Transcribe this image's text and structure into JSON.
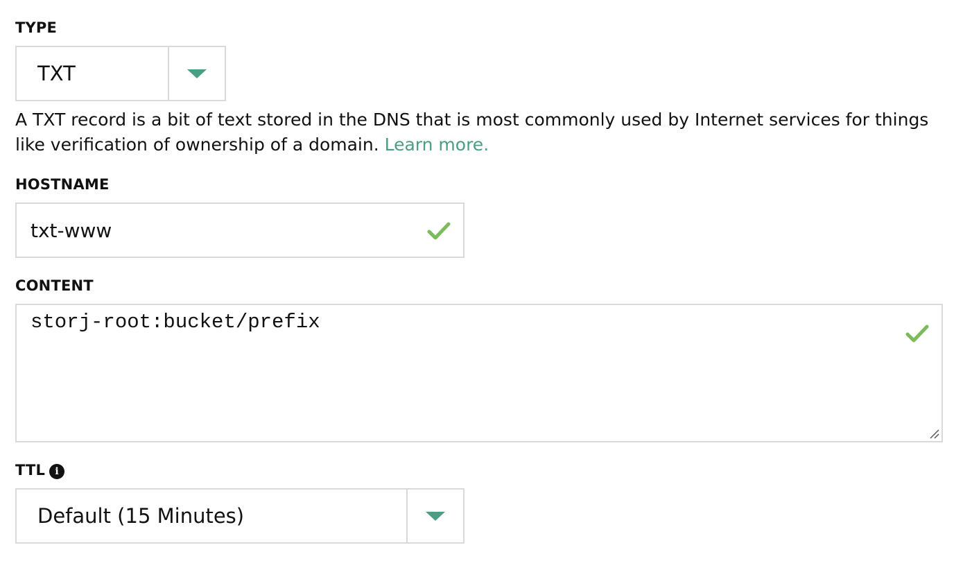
{
  "type_field": {
    "label": "TYPE",
    "selected": "TXT",
    "caret_icon": "caret-down-icon"
  },
  "help": {
    "text": "A TXT record is a bit of text stored in the DNS that is most commonly used by Internet services for things like verification of ownership of a domain. ",
    "link_text": "Learn more."
  },
  "hostname_field": {
    "label": "HOSTNAME",
    "value": "txt-www",
    "valid_icon": "check-icon"
  },
  "content_field": {
    "label": "CONTENT",
    "value": "storj-root:bucket/prefix",
    "valid_icon": "check-icon"
  },
  "ttl_field": {
    "label": "TTL",
    "info_icon": "info-icon",
    "info_glyph": "i",
    "selected": "Default (15 Minutes)",
    "caret_icon": "caret-down-icon"
  },
  "colors": {
    "accent": "#4a9e86",
    "valid": "#7cbb5b",
    "border": "#d9d9d9",
    "text": "#111111"
  }
}
